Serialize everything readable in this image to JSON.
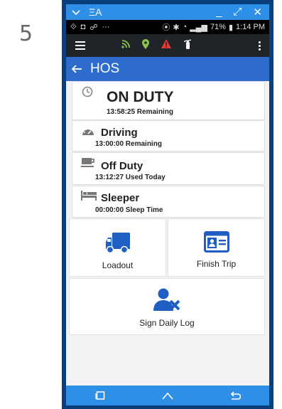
{
  "step_number": "5",
  "window_bar": {
    "title_glyph": "ΞA",
    "minimize": "_",
    "restore": "⤢",
    "close": "✕"
  },
  "status_bar": {
    "left_icons": [
      "⟐",
      "◘",
      "☍",
      "···"
    ],
    "battery": "71%",
    "time": "1:14 PM"
  },
  "toolbar": {
    "icons": [
      "rss-icon",
      "location-icon",
      "warning-icon",
      "fire-extinguisher-icon"
    ]
  },
  "appbar": {
    "title": "HOS"
  },
  "hos_statuses": [
    {
      "label": "ON DUTY",
      "sub": "13:58:25 Remaining",
      "icon": "clock-icon"
    },
    {
      "label": "Driving",
      "sub": "13:00:00 Remaining",
      "icon": "speedometer-icon"
    },
    {
      "label": "Off Duty",
      "sub": "13:12:27 Used Today",
      "icon": "coffee-cup-icon"
    },
    {
      "label": "Sleeper",
      "sub": "00:00:00 Sleep Time",
      "icon": "bed-icon"
    }
  ],
  "actions": {
    "loadout": "Loadout",
    "finish_trip": "Finish Trip",
    "sign_daily_log": "Sign Daily Log"
  },
  "colors": {
    "app_blue": "#2d6ccd",
    "icon_blue": "#1f5fc4",
    "window_blue": "#2e8fe6",
    "toolbar_dark": "#1f2428",
    "rss_green": "#8bc34a",
    "warning_red": "#e53935"
  }
}
